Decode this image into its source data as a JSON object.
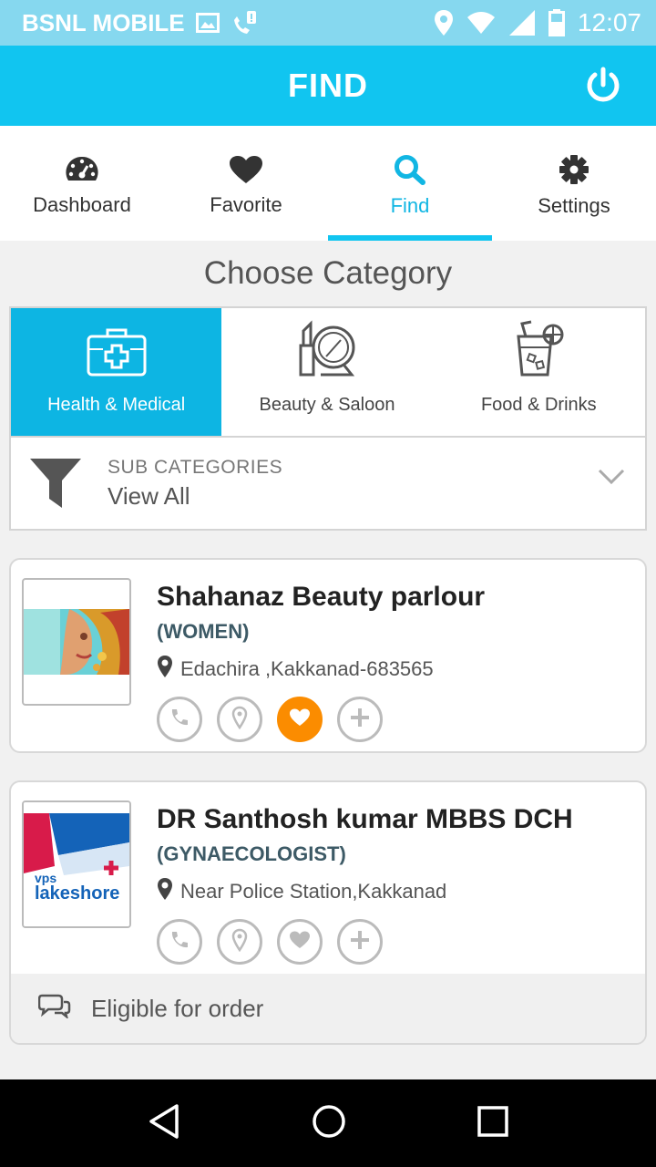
{
  "status_bar": {
    "carrier": "BSNL MOBILE",
    "time": "12:07",
    "icons": [
      "image-icon",
      "missed-call-icon",
      "location-icon",
      "wifi-icon",
      "signal-icon",
      "battery-icon"
    ]
  },
  "app_bar": {
    "title": "FIND",
    "power_icon": "power-icon"
  },
  "tabs": [
    {
      "label": "Dashboard",
      "icon": "dashboard-gauge-icon",
      "active": false
    },
    {
      "label": "Favorite",
      "icon": "heart-icon",
      "active": false
    },
    {
      "label": "Find",
      "icon": "search-icon",
      "active": true
    },
    {
      "label": "Settings",
      "icon": "gear-icon",
      "active": false
    }
  ],
  "choose_category": {
    "title": "Choose Category",
    "categories": [
      {
        "label": "Health & Medical",
        "icon": "medical-kit-icon",
        "selected": true
      },
      {
        "label": "Beauty & Saloon",
        "icon": "lipstick-mirror-icon",
        "selected": false
      },
      {
        "label": "Food & Drinks",
        "icon": "drink-glass-icon",
        "selected": false
      }
    ],
    "sub_categories": {
      "label": "SUB CATEGORIES",
      "value": "View All"
    }
  },
  "listings": [
    {
      "name": "Shahanaz Beauty parlour",
      "category": "(WOMEN)",
      "address": "Edachira ,Kakkanad-683565",
      "favorited": true
    },
    {
      "name": "DR Santhosh kumar MBBS DCH",
      "category": "(GYNAECOLOGIST)",
      "address": "Near Police Station,Kakkanad",
      "favorited": false,
      "logo_text": "vps lakeshore",
      "eligible_text": "Eligible for order"
    }
  ],
  "colors": {
    "primary": "#11c5f0",
    "status_bar": "#86d8ef",
    "favorite": "#fb8c00"
  }
}
